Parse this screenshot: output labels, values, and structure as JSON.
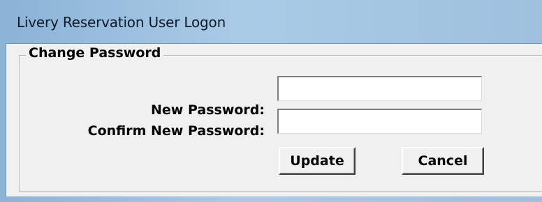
{
  "window": {
    "title": "Livery Reservation User Logon"
  },
  "group": {
    "legend": "Change Password"
  },
  "form": {
    "new_password_label": "New Password:",
    "new_password_value": "",
    "confirm_password_label": "Confirm New Password:",
    "confirm_password_value": ""
  },
  "buttons": {
    "update_label": "Update",
    "cancel_label": "Cancel"
  },
  "colors": {
    "titlebar": "#aacbe6",
    "dialog_background": "#f0f0f0"
  }
}
